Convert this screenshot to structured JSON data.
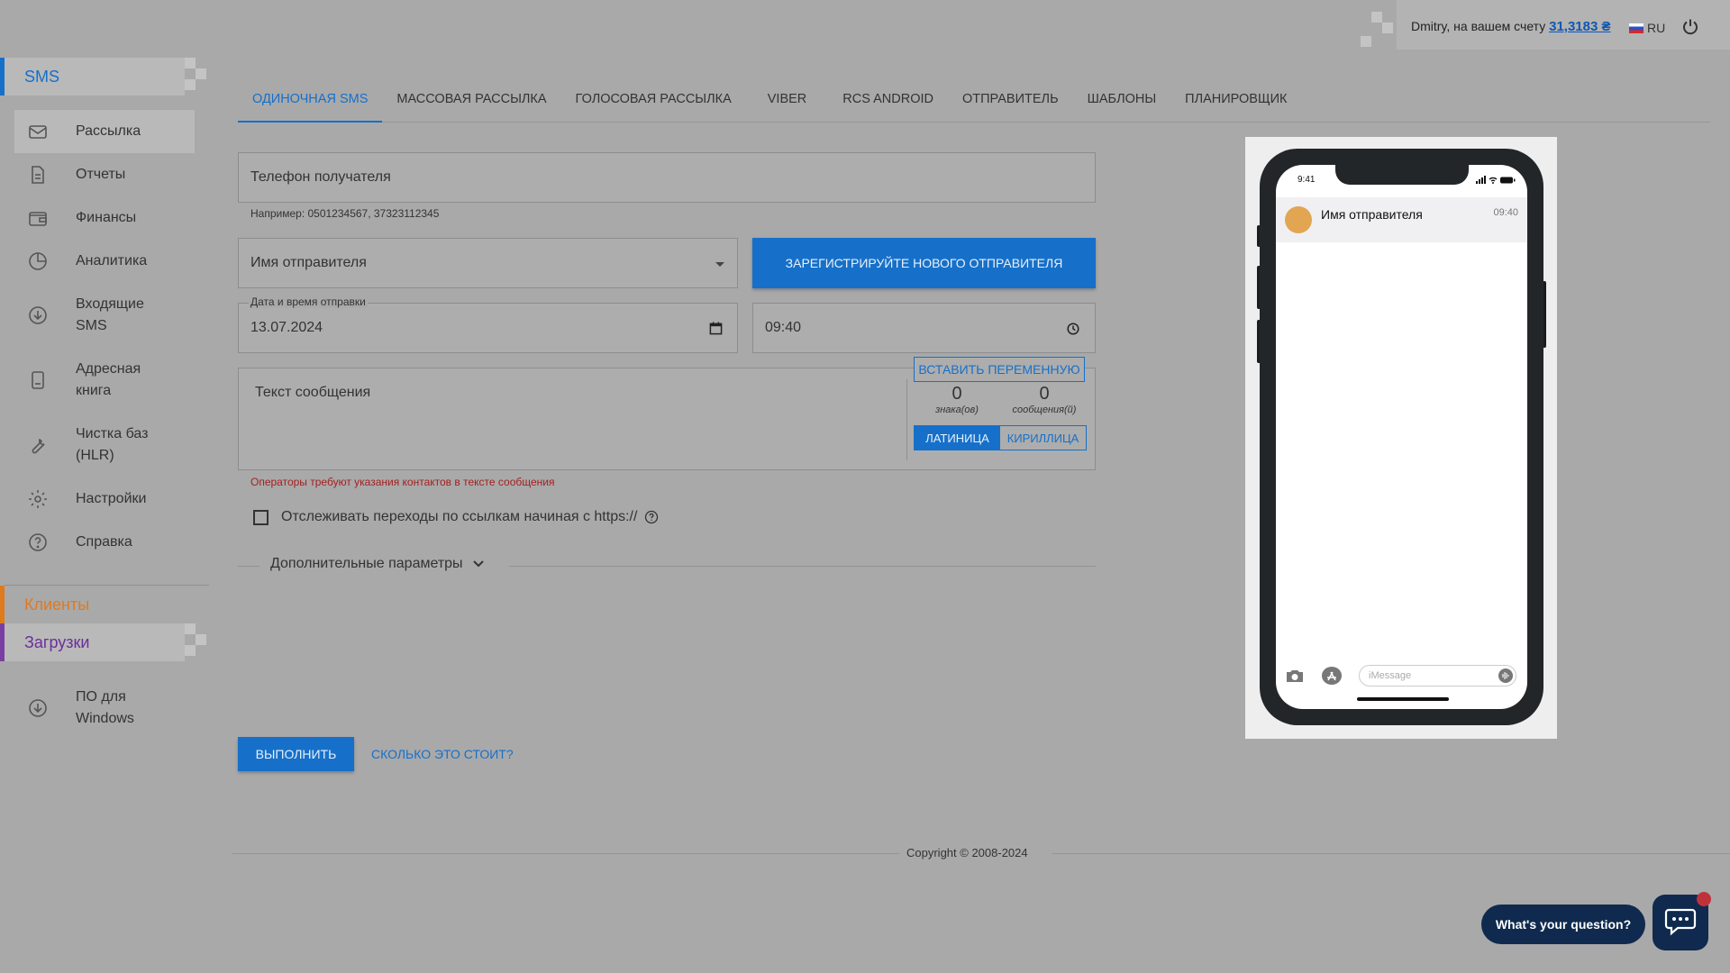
{
  "topbar": {
    "account_prefix": "Dmitry, на вашем счету",
    "balance": "31,3183 ₴",
    "language": "RU"
  },
  "sidebar": {
    "section_sms": "SMS",
    "items": [
      {
        "label": "Рассылка",
        "icon": "envelope-icon"
      },
      {
        "label": "Отчеты",
        "icon": "document-icon"
      },
      {
        "label": "Финансы",
        "icon": "wallet-icon"
      },
      {
        "label": "Аналитика",
        "icon": "pie-chart-icon"
      },
      {
        "label": "Входящие SMS",
        "icon": "download-circle-icon"
      },
      {
        "label": "Адресная книга",
        "icon": "address-book-icon"
      },
      {
        "label": "Чистка баз (HLR)",
        "icon": "wrench-icon"
      },
      {
        "label": "Настройки",
        "icon": "gear-icon"
      },
      {
        "label": "Справка",
        "icon": "help-circle-icon"
      }
    ],
    "section_clients": "Клиенты",
    "section_downloads": "Загрузки",
    "windows_item": "ПО для Windows"
  },
  "tabs": [
    "ОДИНОЧНАЯ SMS",
    "МАССОВАЯ РАССЫЛКА",
    "ГОЛОСОВАЯ РАССЫЛКА",
    "VIBER",
    "RCS ANDROID",
    "ОТПРАВИТЕЛЬ",
    "ШАБЛОНЫ",
    "ПЛАНИРОВЩИК"
  ],
  "form": {
    "phone_placeholder": "Телефон получателя",
    "phone_hint": "Например: 0501234567, 37323112345",
    "sender_placeholder": "Имя отправителя",
    "register_sender": "ЗАРЕГИСТРИРУЙТЕ НОВОГО ОТПРАВИТЕЛЯ",
    "datetime_label": "Дата и время отправки",
    "date": "13.07.2024",
    "time": "09:40",
    "message_placeholder": "Текст сообщения",
    "insert_variable": "ВСТАВИТЬ ПЕРЕМЕННУЮ",
    "chars_count": "0",
    "chars_label": "знака(ов)",
    "messages_count": "0",
    "messages_label": "сообщения(й)",
    "latin": "ЛАТИНИЦА",
    "cyrillic": "КИРИЛЛИЦА",
    "error": "Операторы требуют указания контактов в тексте сообщения",
    "track_links": "Отслеживать переходы по ссылкам начиная с https://",
    "advanced": "Дополнительные параметры",
    "run": "ВЫПОЛНИТЬ",
    "cost": "СКОЛЬКО ЭТО СТОИТ?"
  },
  "footer": {
    "copyright": "Copyright © 2008-2024"
  },
  "preview": {
    "status_time": "9:41",
    "sender": "Имя отправителя",
    "time": "09:40",
    "imessage_placeholder": "iMessage"
  },
  "chat_widget": {
    "question": "What's your question?"
  },
  "colors": {
    "accent": "#1670c9",
    "clients": "#e07a1f",
    "downloads": "#7a3ea3",
    "error": "#a52020",
    "avatar": "#e2a552"
  }
}
